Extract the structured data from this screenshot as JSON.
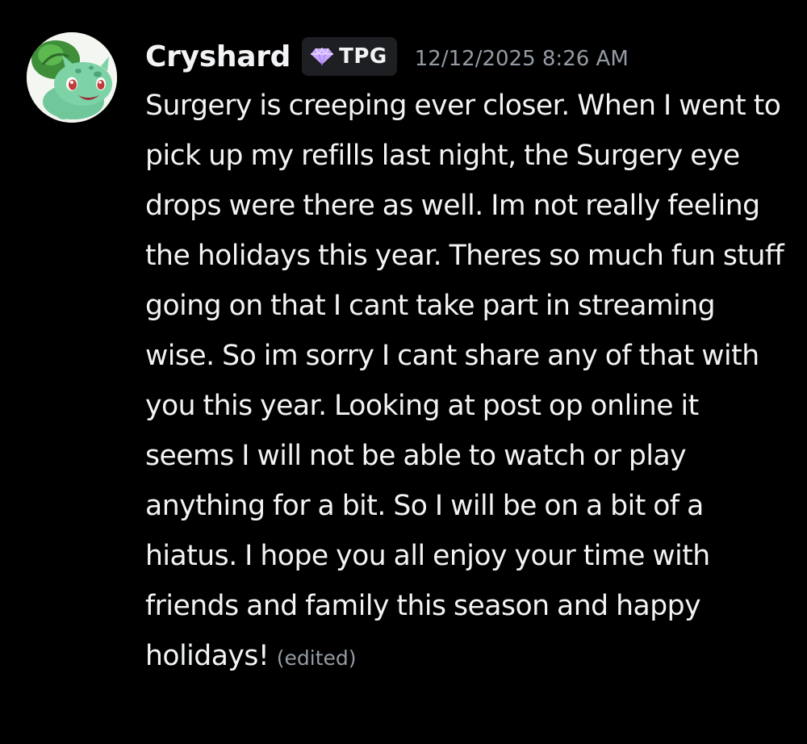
{
  "message": {
    "author": {
      "username": "Cryshard",
      "tag": "TPG",
      "avatar_icon": "bulbasaur-avatar",
      "username_color": "#f2f3f5"
    },
    "timestamp": "12/12/2025 8:26 AM",
    "content": "Surgery is creeping ever closer. When I went to pick up my refills last night, the Surgery eye drops were there as well. Im not really feeling the holidays this year. Theres so much fun stuff going on that I cant take part in streaming wise. So im sorry I cant share any of that with you this year. Looking at post op online it seems I will not be able to watch or play anything for a bit. So I will be on a bit of a hiatus. I hope you all enjoy your time with friends and family this season and happy holidays!",
    "edited_label": "(edited)",
    "tag_icon": "purple-gem-icon",
    "colors": {
      "background": "#000000",
      "text": "#f2f3f5",
      "muted": "#949ba4",
      "tag_background": "#1e1f22",
      "tag_gem": "#c9a6ff"
    }
  }
}
